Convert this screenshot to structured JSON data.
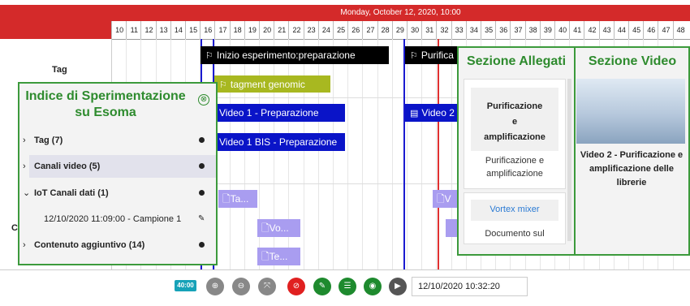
{
  "timeline": {
    "date_header": "Monday, October 12, 2020, 10:00",
    "ticks": [
      "10",
      "11",
      "12",
      "13",
      "14",
      "15",
      "16",
      "17",
      "18",
      "19",
      "20",
      "21",
      "22",
      "23",
      "24",
      "25",
      "26",
      "27",
      "28",
      "29",
      "30",
      "31",
      "32",
      "33",
      "34",
      "35",
      "36",
      "37",
      "38",
      "39",
      "40",
      "41",
      "42",
      "43",
      "44",
      "45",
      "46",
      "47",
      "48"
    ]
  },
  "rows": {
    "tag_label": "Tag",
    "partial_label": "C"
  },
  "events": {
    "e1": "Inizio esperimento:preparazione",
    "e2": "Purifica",
    "e3": "tagment genomic",
    "e4": "Video 1 - Preparazione",
    "e5": "Video 2",
    "e6": "Video 1 BIS - Preparazione",
    "d1": "Ta...",
    "d2": "V",
    "d3": "Vo...",
    "d4": "Te..."
  },
  "index_panel": {
    "title": "Indice di Sperimentazione su Esoma",
    "close_icon": "⊗",
    "items": [
      {
        "label": "Tag (7)",
        "chevron": "›"
      },
      {
        "label": "Canali video (5)",
        "chevron": "›"
      },
      {
        "label": "IoT Canali dati (1)",
        "chevron": "⌄"
      },
      {
        "label": "Contenuto aggiuntivo (14)",
        "chevron": "›"
      }
    ],
    "sub_item": "12/10/2020 11:09:00 - Campione 1"
  },
  "attachments_panel": {
    "title_allegati": "Sezione Allegati",
    "title_video": "Sezione Video",
    "card1_title_1": "Purificazione",
    "card1_title_2": "e",
    "card1_title_3": "amplificazione",
    "card1_desc_1": "Purificazione e",
    "card1_desc_2": "amplificazione",
    "card2_title": "Vortex mixer",
    "card2_desc": "Documento sul",
    "video_title_1": "Video 2 - Purificazione e",
    "video_title_2": "amplificazione delle",
    "video_title_3": "librerie"
  },
  "toolbar": {
    "badge": "40:00",
    "datetime": "12/10/2020 10:32:20"
  },
  "colors": {
    "header_red": "#d42a2a",
    "event_black": "#000000",
    "event_olive": "#a8b820",
    "event_blue": "#0a14c8",
    "doc_purple": "#a99df0",
    "panel_green": "#3c9a3c"
  }
}
